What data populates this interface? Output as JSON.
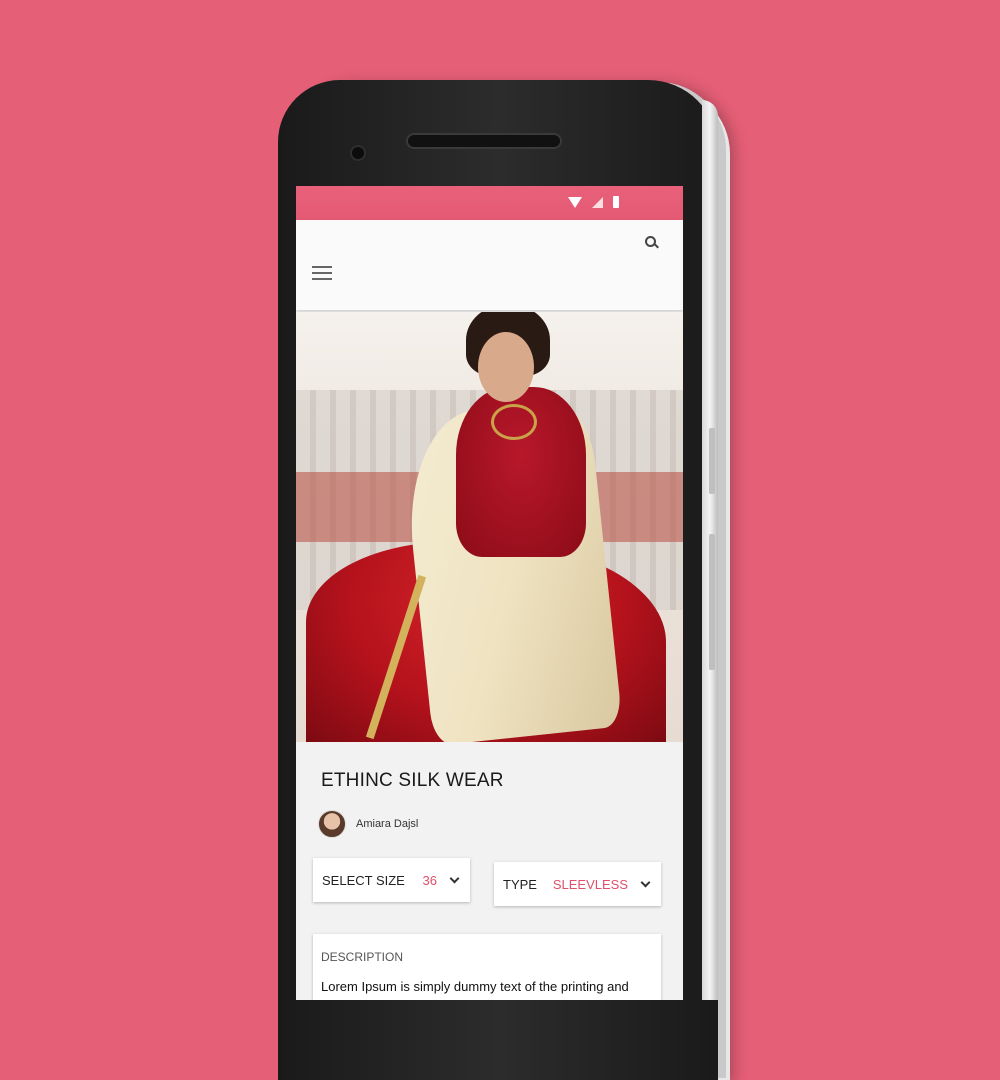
{
  "background_color": "#e55f76",
  "accent_color": "#e0506a",
  "status_bar": {
    "icons": [
      "wifi-icon",
      "signal-icon",
      "battery-icon"
    ]
  },
  "app_bar": {
    "icons": [
      "menu-icon",
      "search-icon"
    ]
  },
  "product": {
    "title": "ETHINC SILK WEAR",
    "seller_name": "Amiara Dajsl"
  },
  "size_select": {
    "label": "SELECT SIZE",
    "value": "36"
  },
  "type_select": {
    "label": "TYPE",
    "value": "SLEEVLESS"
  },
  "description": {
    "heading": "DESCRIPTION",
    "body": "Lorem Ipsum is simply dummy text of the printing and"
  }
}
